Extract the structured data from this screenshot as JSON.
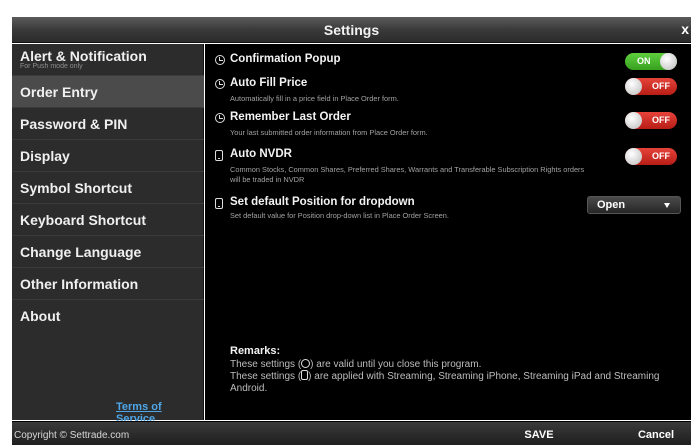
{
  "window": {
    "title": "Settings",
    "close_glyph": "x"
  },
  "sidebar": {
    "items": [
      {
        "label": "Alert & Notification",
        "sub": "For Push mode only"
      },
      {
        "label": "Order Entry",
        "active": true
      },
      {
        "label": "Password & PIN"
      },
      {
        "label": "Display"
      },
      {
        "label": "Symbol Shortcut"
      },
      {
        "label": "Keyboard Shortcut"
      },
      {
        "label": "Change Language"
      },
      {
        "label": "Other Information"
      },
      {
        "label": "About"
      }
    ],
    "terms_link": "Terms of Service"
  },
  "settings": [
    {
      "icon": "clock-icon",
      "label": "Confirmation Popup",
      "description": "",
      "control": "toggle",
      "state": "ON"
    },
    {
      "icon": "clock-icon",
      "label": "Auto Fill Price",
      "description": "Automatically fill in a price field in Place Order form.",
      "control": "toggle",
      "state": "OFF"
    },
    {
      "icon": "clock-icon",
      "label": "Remember Last Order",
      "description": "Your last submitted order information from Place Order form.",
      "control": "toggle",
      "state": "OFF"
    },
    {
      "icon": "phone-icon",
      "label": "Auto NVDR",
      "description": "Common Stocks, Common Shares, Preferred Shares, Warrants and Transferable Subscription Rights orders will be traded in NVDR",
      "control": "toggle",
      "state": "OFF"
    },
    {
      "icon": "phone-icon",
      "label": "Set default Position for dropdown",
      "description": "Set default value for Position drop-down list in Place Order Screen.",
      "control": "select",
      "value": "Open"
    }
  ],
  "remarks": {
    "title": "Remarks:",
    "line1_pre": "These settings (",
    "line1_post": ") are valid until you close this program.",
    "line2_pre": "These settings (",
    "line2_post": ") are applied with Streaming, Streaming iPhone, Streaming iPad and Streaming Android."
  },
  "footer": {
    "copyright": "Copyright © Settrade.com",
    "save": "SAVE",
    "cancel": "Cancel"
  },
  "colors": {
    "toggle_on": "#3fae25",
    "toggle_off": "#d22f27",
    "link": "#4fa6e8",
    "active_item": "#4b4b4b"
  }
}
